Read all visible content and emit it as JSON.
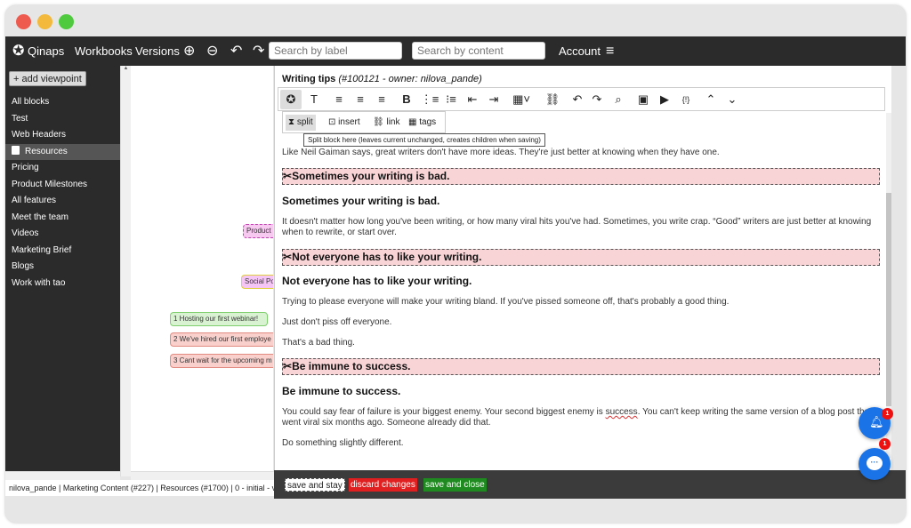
{
  "navbar": {
    "brand": "Qinaps",
    "workbooks": "Workbooks",
    "versions": "Versions",
    "search_label_placeholder": "Search by label",
    "search_content_placeholder": "Search by content",
    "account": "Account"
  },
  "sidebar": {
    "add_viewpoint": "+ add viewpoint",
    "items": [
      "All blocks",
      "Test",
      "Web Headers",
      "Resources",
      "Pricing",
      "Product Milestones",
      "All features",
      "Meet the team",
      "Videos",
      "Marketing Brief",
      "Blogs",
      "Work with tao"
    ],
    "active_item": "Resources"
  },
  "canvas": {
    "nodes": [
      "Product M",
      "Social Pos",
      "1 Hosting our first webinar!",
      "2 We've hired our first employe",
      "3 Cant wait for the upcoming m"
    ]
  },
  "status_bar": "nilova_pande | Marketing Content (#227) | Resources (#1700) | 0 - initial - v",
  "editor": {
    "title": "Writing tips",
    "meta": "(#100121 - owner: nilova_pande)",
    "toolbar2": {
      "split": "split",
      "insert": "insert",
      "link": "link",
      "tags": "tags"
    },
    "tooltip": "Split block here (leaves current unchanged, creates children when saving)",
    "intro": "Like Neil Gaiman says, great writers don't have more ideas. They're just better at knowing when they have one.",
    "split_marks": [
      "Sometimes your writing is bad.",
      "Not everyone has to like your writing.",
      "Be immune to success."
    ],
    "h1": "Sometimes your writing is bad.",
    "p1": "It doesn't matter how long you've been writing, or how many viral hits you've had. Sometimes, you write crap. “Good” writers are just better at knowing when to rewrite, or start over.",
    "h2": "Not everyone has to like your writing.",
    "p2a": "Trying to please everyone will make your writing bland. If you've pissed someone off, that's probably a good thing.",
    "p2b": "Just don't piss off everyone.",
    "p2c": "That's a bad thing.",
    "h3": "Be immune to success.",
    "p3a_before": "You could say fear of failure is your biggest enemy. Your second biggest enemy is ",
    "p3a_word": "success",
    "p3a_after": ". You can't keep writing the same version of a blog post that went viral six months ago. Someone already did that.",
    "p3b": "Do something slightly different."
  },
  "footer": {
    "save_stay": "save and stay",
    "discard": "discard changes",
    "save_close": "save and close"
  },
  "badges": {
    "notification_count": "1",
    "chat_count": "1"
  },
  "colors": {
    "navbar_bg": "#2b2b2b",
    "split_bg": "#f9d4d6",
    "discard_bg": "#e02020",
    "save_close_bg": "#1f8a1f",
    "fab_blue": "#1b73e8"
  }
}
